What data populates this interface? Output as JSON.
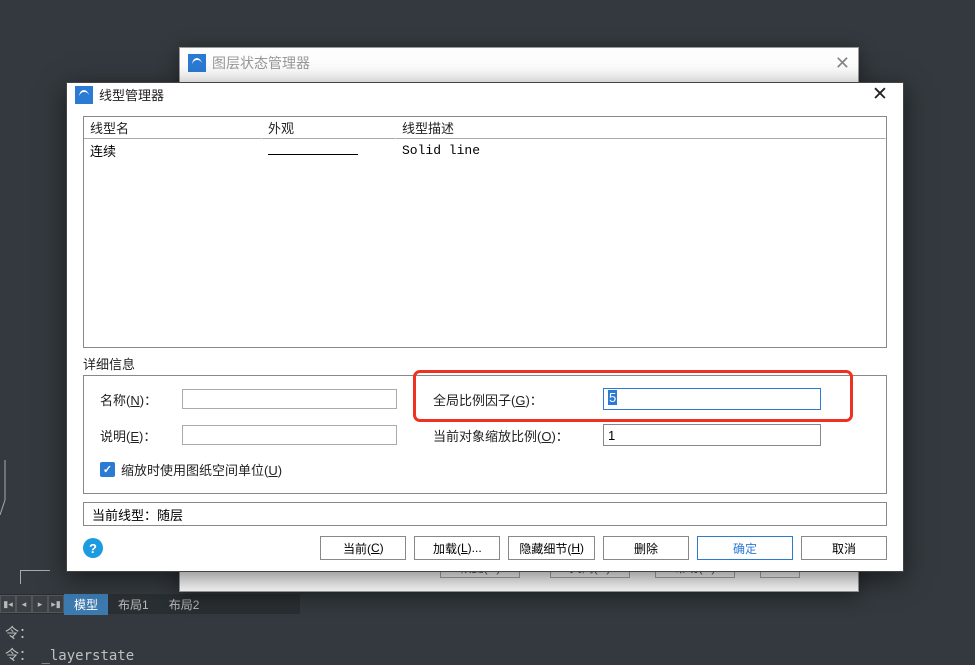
{
  "back_dialog": {
    "title": "图层状态管理器",
    "buttons": {
      "restore": "恢复(R)",
      "close": "关闭(C)",
      "help": "帮助(H)",
      "more": ">>"
    }
  },
  "dialog": {
    "title": "线型管理器",
    "grid": {
      "headers": {
        "name": "线型名",
        "appearance": "外观",
        "desc": "线型描述"
      },
      "rows": [
        {
          "name": "连续",
          "desc": "Solid line"
        }
      ]
    },
    "details_label": "详细信息",
    "details": {
      "name_label": "名称(N)：",
      "name_value": "",
      "desc_label": "说明(E)：",
      "desc_value": "",
      "global_label": "全局比例因子(G)：",
      "global_value": "5",
      "obj_scale_label": "当前对象缩放比例(O)：",
      "obj_scale_value": "1",
      "paper_units": "缩放时使用图纸空间单位(U)"
    },
    "current_linetype_label": "当前线型：",
    "current_linetype_value": "随层",
    "buttons": {
      "current": "当前(C)",
      "load": "加载(L)...",
      "hide": "隐藏细节(H)",
      "delete": "删除",
      "ok": "确定",
      "cancel": "取消"
    }
  },
  "bg": {
    "tabs": {
      "model": "模型",
      "layout1": "布局1",
      "layout2": "布局2"
    },
    "cmd_prompt": "令：",
    "cmd_text": "_layerstate"
  }
}
